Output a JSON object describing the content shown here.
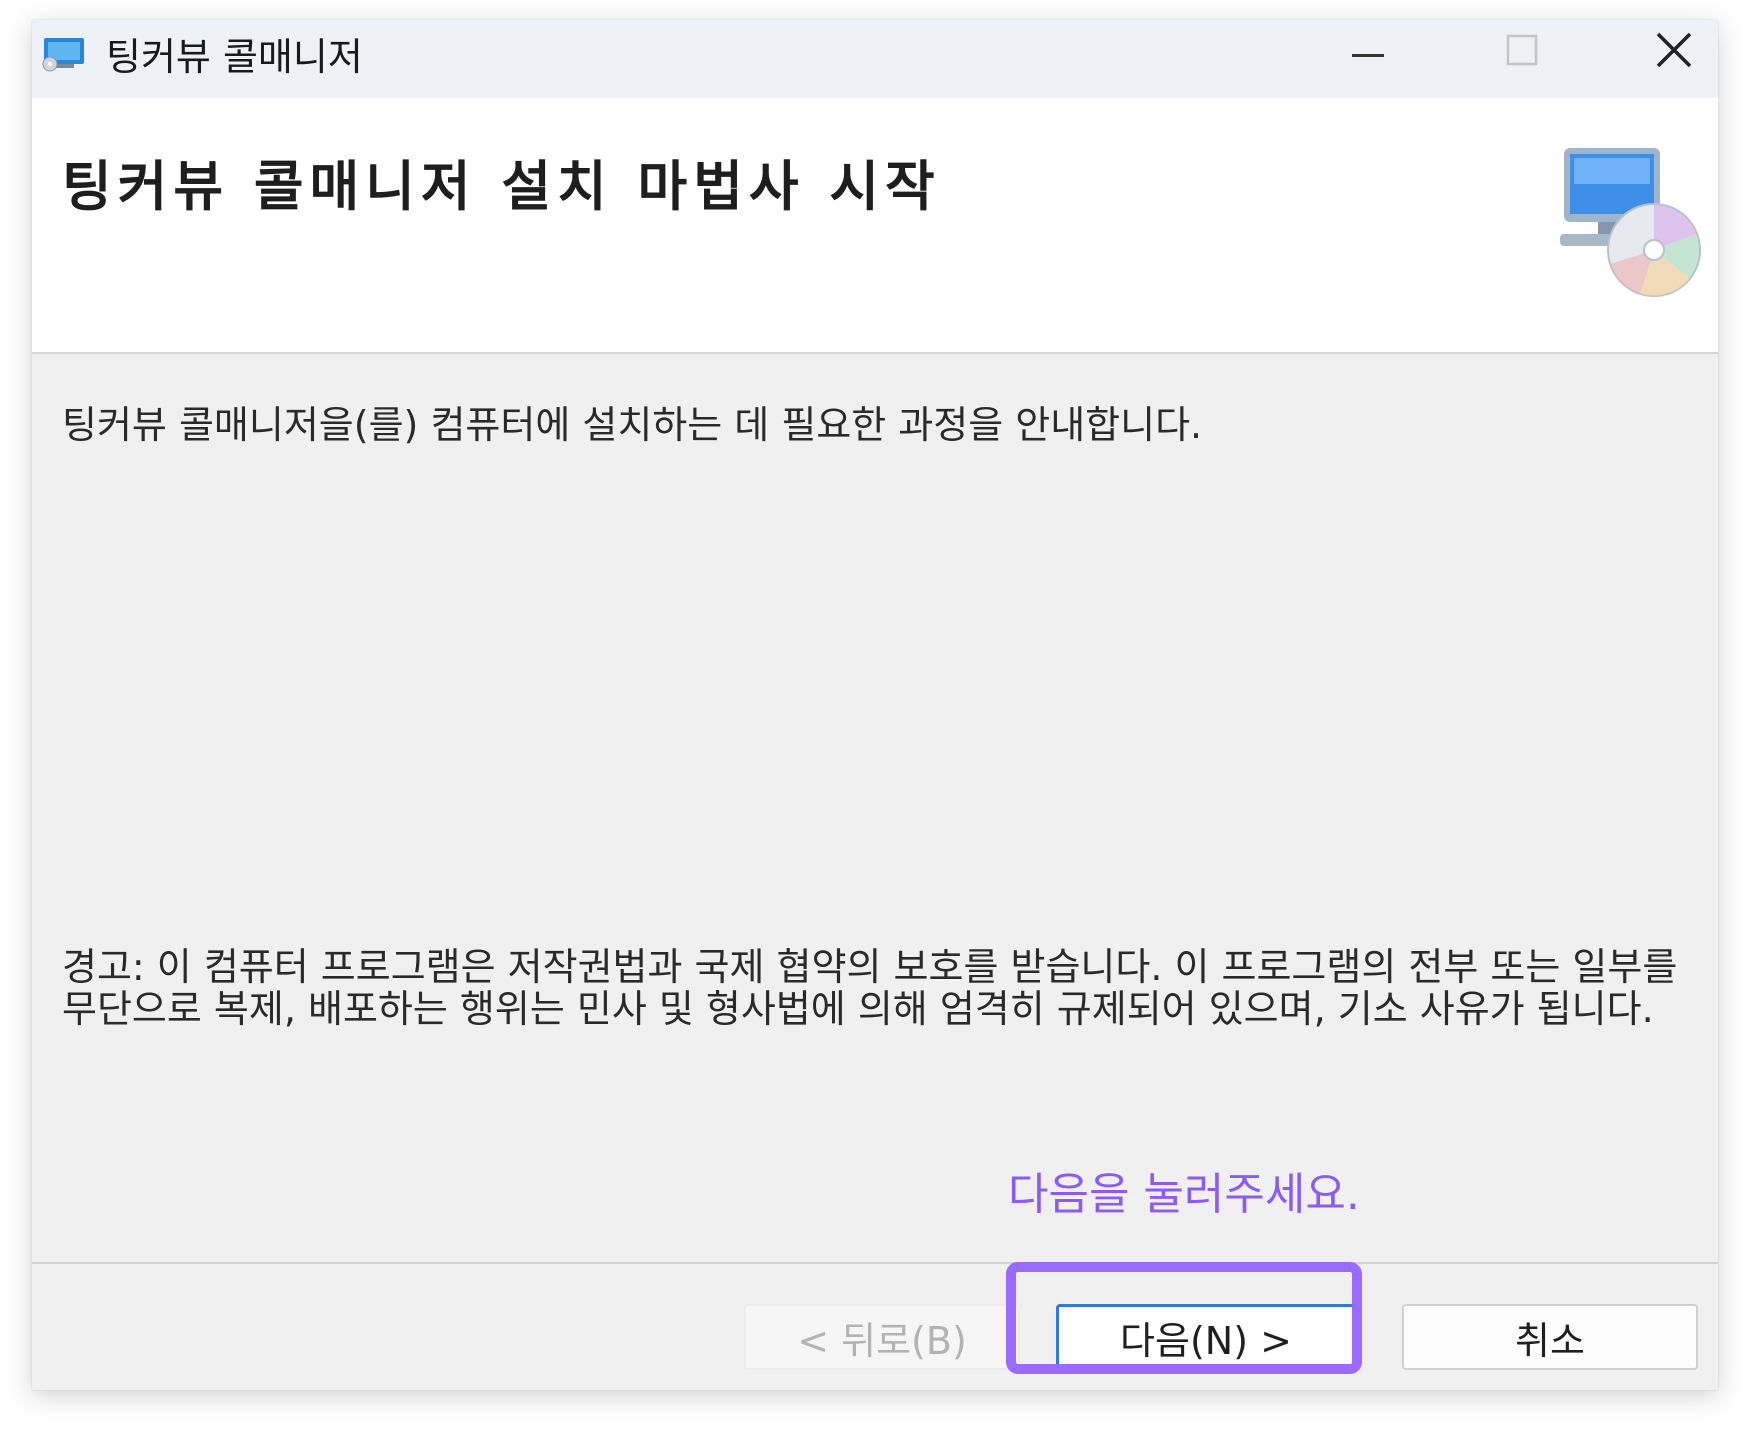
{
  "window": {
    "title": "팅커뷰 콜매니저"
  },
  "header": {
    "title": "팅커뷰 콜매니저 설치 마법사 시작"
  },
  "body": {
    "intro": "팅커뷰 콜매니저을(를) 컴퓨터에 설치하는 데 필요한 과정을 안내합니다.",
    "warning": "경고: 이 컴퓨터 프로그램은 저작권법과 국제 협약의 보호를 받습니다. 이 프로그램의 전부 또는 일부를 무단으로 복제, 배포하는 행위는 민사 및 형사법에 의해 엄격히 규제되어 있으며, 기소 사유가 됩니다."
  },
  "annotation": {
    "hint": "다음을 눌러주세요.",
    "highlight_color": "#9b6bff",
    "text_color": "#8c5cf2"
  },
  "buttons": {
    "back": "< 뒤로(B)",
    "next": "다음(N) >",
    "cancel": "취소"
  },
  "icons": {
    "app": "installer-app-icon",
    "setup": "computer-disc-icon",
    "minimize": "minimize-icon",
    "maximize": "maximize-icon",
    "close": "close-icon"
  }
}
